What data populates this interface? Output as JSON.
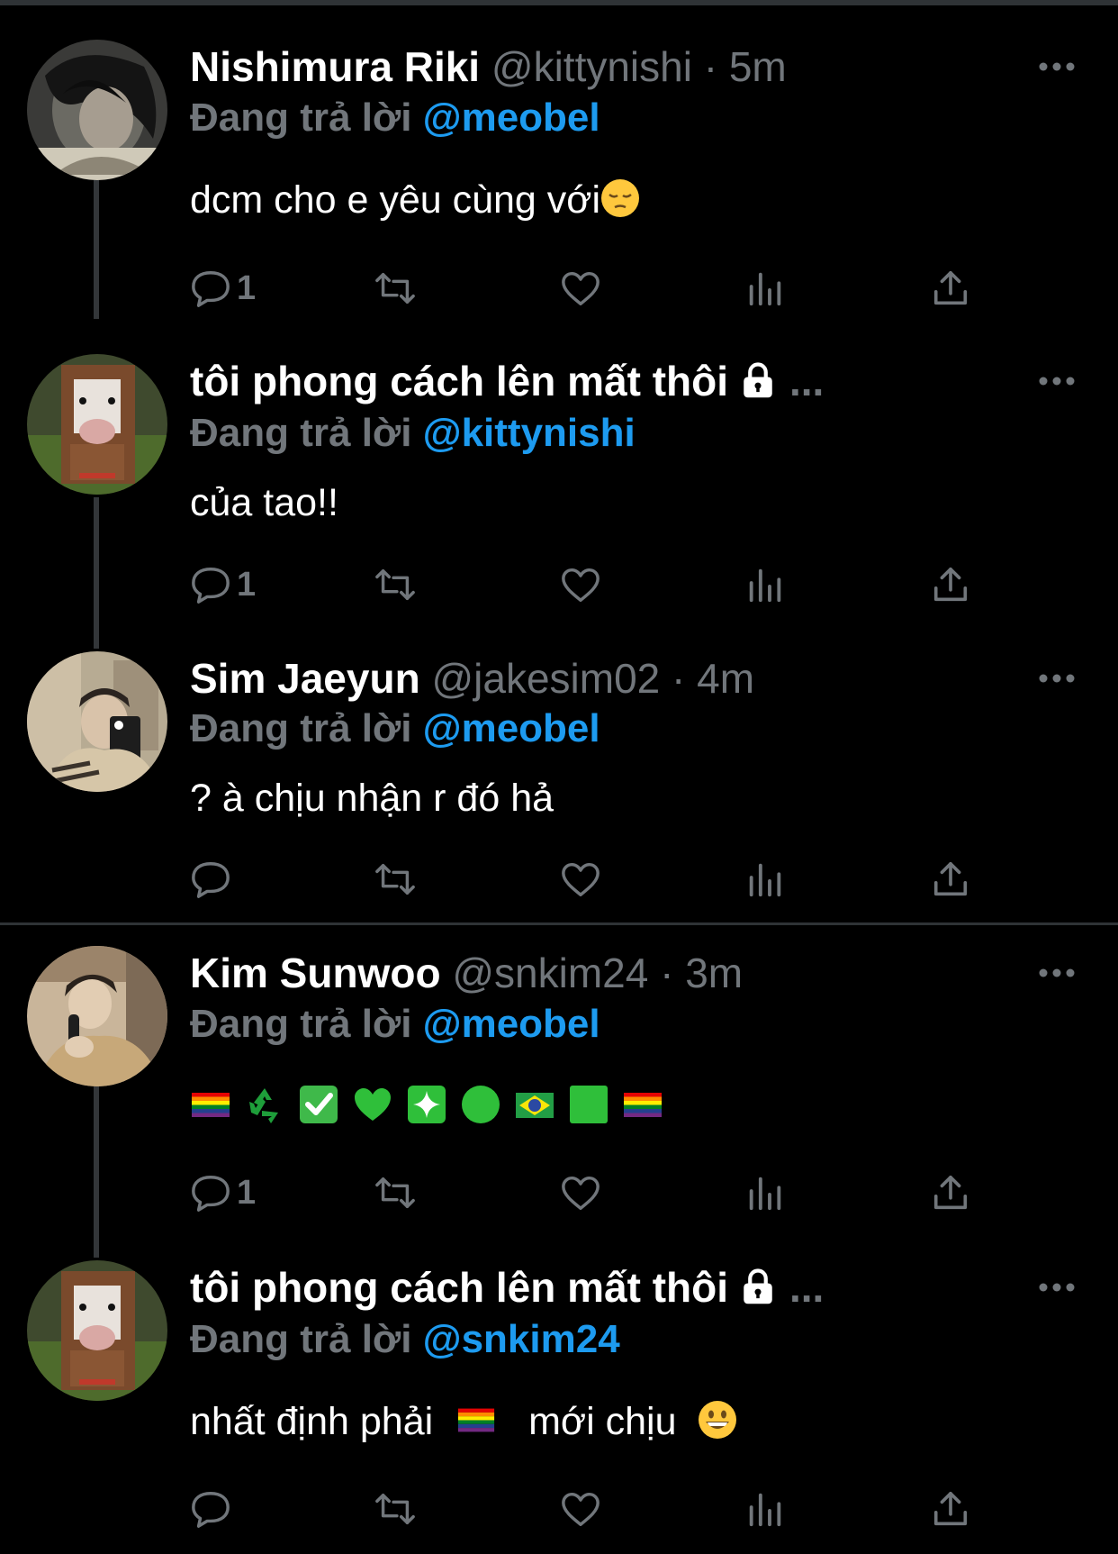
{
  "colors": {
    "background": "#000000",
    "text": "#ffffff",
    "muted": "#71767b",
    "mention": "#1d9bf0",
    "divider": "#2f3336"
  },
  "tweets": [
    {
      "name": "Nishimura Riki",
      "handle": "@kittynishi",
      "time": "· 5m",
      "reply_prefix": "Đang trả lời",
      "reply_mention": "@meobel",
      "text": "dcm cho e yêu cùng với",
      "text_emoji": "pensive-face",
      "reply_count": "1",
      "avatar": "portrait-photo-avatar"
    },
    {
      "name": "tôi phong cách lên mất thôi",
      "name_suffix": "...",
      "protected": true,
      "reply_prefix": "Đang trả lời",
      "reply_mention": "@kittynishi",
      "text": "của tao!!",
      "reply_count": "1",
      "avatar": "cow-photo-avatar"
    },
    {
      "name": "Sim Jaeyun",
      "handle": "@jakesim02",
      "time": "· 4m",
      "reply_prefix": "Đang trả lời",
      "reply_mention": "@meobel",
      "text": "? à chịu nhận r đó hả",
      "reply_count": "",
      "avatar": "selfie-photo-avatar"
    },
    {
      "name": "Kim Sunwoo",
      "handle": "@snkim24",
      "time": "· 3m",
      "reply_prefix": "Đang trả lời",
      "reply_mention": "@meobel",
      "emoji_sequence": [
        "rainbow-flag",
        "recycling-symbol",
        "check-mark-button",
        "green-heart",
        "sparkle",
        "green-circle",
        "brazil-flag",
        "green-square",
        "rainbow-flag"
      ],
      "reply_count": "1",
      "avatar": "phone-call-photo-avatar"
    },
    {
      "name": "tôi phong cách lên mất thôi",
      "name_suffix": "...",
      "protected": true,
      "reply_prefix": "Đang trả lời",
      "reply_mention": "@snkim24",
      "text_before": "nhất định phải",
      "text_emoji_mid": "rainbow-flag",
      "text_after": "mới chịu",
      "text_emoji_end": "grinning-face",
      "reply_count": "",
      "avatar": "cow-photo-avatar"
    }
  ]
}
